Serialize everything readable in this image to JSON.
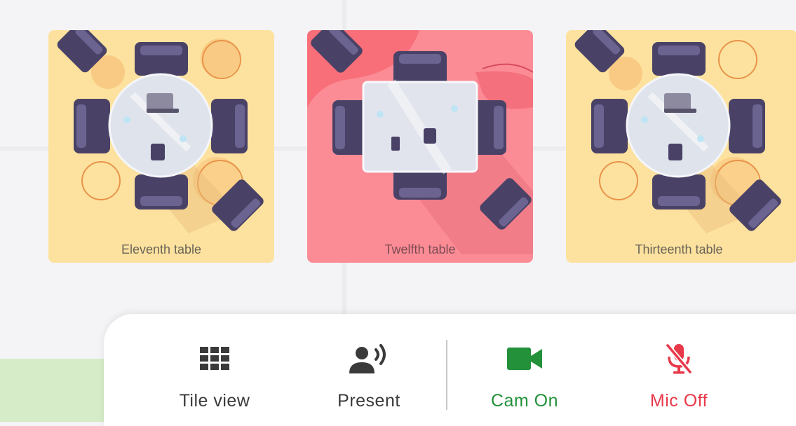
{
  "tables": [
    {
      "label": "Eleventh table",
      "theme": "yellow",
      "shape": "round"
    },
    {
      "label": "Twelfth table",
      "theme": "pink",
      "shape": "square"
    },
    {
      "label": "Thirteenth table",
      "theme": "yellow",
      "shape": "round"
    }
  ],
  "toolbar": {
    "tile_view": {
      "label": "Tile view",
      "icon": "grid-icon"
    },
    "present": {
      "label": "Present",
      "icon": "person-speaking-icon"
    },
    "cam": {
      "label": "Cam On",
      "icon": "video-camera-icon",
      "color": "#23913a"
    },
    "mic": {
      "label": "Mic Off",
      "icon": "mic-off-icon",
      "color": "#e8394a"
    }
  },
  "colors": {
    "yellow_card": "#fde29f",
    "pink_card": "#fb8c96",
    "chair": "#4a4266",
    "icon_dark": "#3a3a3a"
  }
}
